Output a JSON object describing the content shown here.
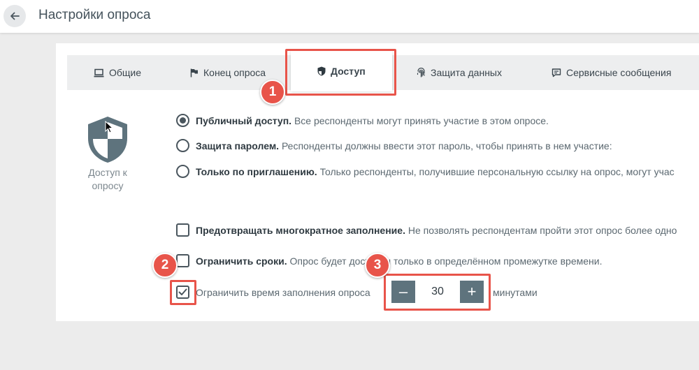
{
  "header": {
    "title": "Настройки опроса"
  },
  "tabs": [
    {
      "label": "Общие"
    },
    {
      "label": "Конец опроса"
    },
    {
      "label": "Доступ",
      "active": true
    },
    {
      "label": "Защита данных"
    },
    {
      "label": "Сервисные сообщения"
    }
  ],
  "sidebar": {
    "label_line1": "Доступ к",
    "label_line2": "опросу"
  },
  "access_options": [
    {
      "title": "Публичный доступ.",
      "desc": " Все респонденты могут принять участие в этом опросе.",
      "selected": true
    },
    {
      "title": "Защита паролем.",
      "desc": " Респонденты должны ввести этот пароль, чтобы принять в нем участие:",
      "selected": false
    },
    {
      "title": "Только по приглашению.",
      "desc": " Только респонденты, получившие персональную ссылку на опрос, могут учас",
      "selected": false
    }
  ],
  "restrictions": [
    {
      "title": "Предотвращать многократное заполнение.",
      "desc": " Не позволять респондентам пройти этот опрос более одно",
      "checked": false
    },
    {
      "title": "Ограничить сроки.",
      "desc": " Опрос будет доступен только в определённом промежутке времени.",
      "checked": false
    },
    {
      "title": "",
      "desc": "Ограничить время заполнения опроса",
      "checked": true
    }
  ],
  "time_limit": {
    "value": "30",
    "unit": "минутами",
    "minus": "–",
    "plus": "+"
  },
  "annotations": {
    "b1": "1",
    "b2": "2",
    "b3": "3",
    "color": "#e8544a"
  },
  "colors": {
    "accent": "#5e737d",
    "tab_bar": "#edeeef",
    "background": "#ececec"
  }
}
